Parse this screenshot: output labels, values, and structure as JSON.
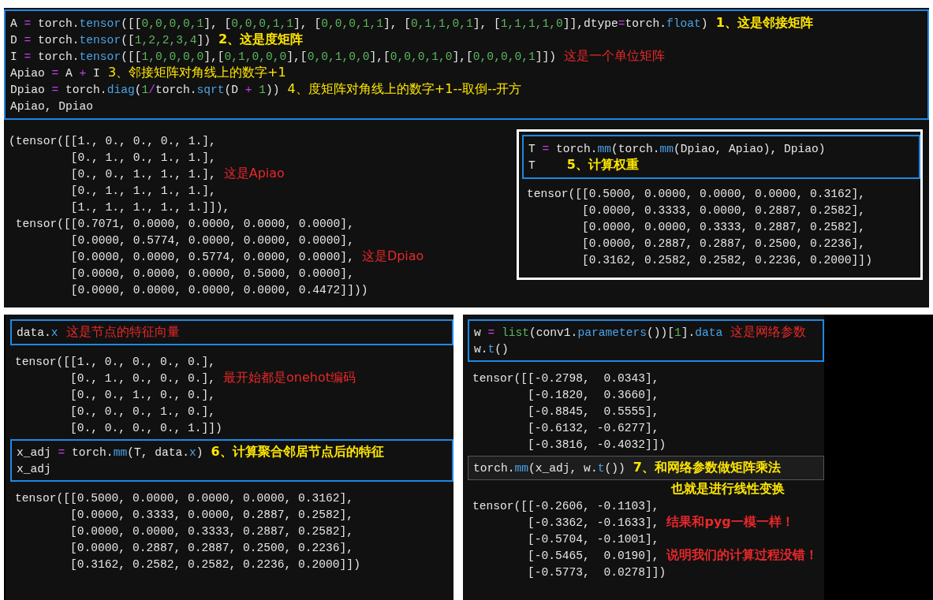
{
  "top": {
    "cell": {
      "kind": "active",
      "lines": [
        {
          "tokens": [
            {
              "text": "A ",
              "kind": "plain"
            },
            {
              "text": "=",
              "kind": "op"
            },
            {
              "text": " torch.",
              "kind": "plain"
            },
            {
              "text": "tensor",
              "kind": "attr"
            },
            {
              "text": "([[",
              "kind": "plain"
            },
            {
              "text": "0,0,0,0,1",
              "kind": "num"
            },
            {
              "text": "], [",
              "kind": "plain"
            },
            {
              "text": "0,0,0,1,1",
              "kind": "num"
            },
            {
              "text": "], [",
              "kind": "plain"
            },
            {
              "text": "0,0,0,1,1",
              "kind": "num"
            },
            {
              "text": "], [",
              "kind": "plain"
            },
            {
              "text": "0,1,1,0,1",
              "kind": "num"
            },
            {
              "text": "], [",
              "kind": "plain"
            },
            {
              "text": "1,1,1,1,0",
              "kind": "num"
            },
            {
              "text": "]],dtype",
              "kind": "plain"
            },
            {
              "text": "=",
              "kind": "op"
            },
            {
              "text": "torch.",
              "kind": "plain"
            },
            {
              "text": "float",
              "kind": "attr"
            },
            {
              "text": ")",
              "kind": "plain"
            }
          ],
          "note": {
            "text": "1、这是邻接矩阵",
            "kind": "step"
          }
        },
        {
          "tokens": [
            {
              "text": "D ",
              "kind": "plain"
            },
            {
              "text": "=",
              "kind": "op"
            },
            {
              "text": " torch.",
              "kind": "plain"
            },
            {
              "text": "tensor",
              "kind": "attr"
            },
            {
              "text": "([",
              "kind": "plain"
            },
            {
              "text": "1,2,2,3,4",
              "kind": "num"
            },
            {
              "text": "])",
              "kind": "plain"
            }
          ],
          "note": {
            "text": "2、这是度矩阵",
            "kind": "step"
          }
        },
        {
          "tokens": [
            {
              "text": "I ",
              "kind": "plain"
            },
            {
              "text": "=",
              "kind": "op"
            },
            {
              "text": " torch.",
              "kind": "plain"
            },
            {
              "text": "tensor",
              "kind": "attr"
            },
            {
              "text": "([[",
              "kind": "plain"
            },
            {
              "text": "1,0,0,0,0",
              "kind": "num"
            },
            {
              "text": "],[",
              "kind": "plain"
            },
            {
              "text": "0,1,0,0,0",
              "kind": "num"
            },
            {
              "text": "],[",
              "kind": "plain"
            },
            {
              "text": "0,0,1,0,0",
              "kind": "num"
            },
            {
              "text": "],[",
              "kind": "plain"
            },
            {
              "text": "0,0,0,1,0",
              "kind": "num"
            },
            {
              "text": "],[",
              "kind": "plain"
            },
            {
              "text": "0,0,0,0,1",
              "kind": "num"
            },
            {
              "text": "]])",
              "kind": "plain"
            }
          ],
          "note": {
            "text": "这是一个单位矩阵",
            "kind": "remark"
          }
        },
        {
          "tokens": [
            {
              "text": "Apiao ",
              "kind": "plain"
            },
            {
              "text": "=",
              "kind": "op"
            },
            {
              "text": " A ",
              "kind": "plain"
            },
            {
              "text": "+",
              "kind": "op"
            },
            {
              "text": " I",
              "kind": "plain"
            }
          ],
          "note": {
            "text": "3、邻接矩阵对角线上的数字+1",
            "kind": "hint"
          }
        },
        {
          "tokens": [
            {
              "text": "Dpiao ",
              "kind": "plain"
            },
            {
              "text": "=",
              "kind": "op"
            },
            {
              "text": " torch.",
              "kind": "plain"
            },
            {
              "text": "diag",
              "kind": "attr"
            },
            {
              "text": "(",
              "kind": "plain"
            },
            {
              "text": "1",
              "kind": "num"
            },
            {
              "text": "/",
              "kind": "op"
            },
            {
              "text": "torch.",
              "kind": "plain"
            },
            {
              "text": "sqrt",
              "kind": "attr"
            },
            {
              "text": "(D ",
              "kind": "plain"
            },
            {
              "text": "+",
              "kind": "op"
            },
            {
              "text": " 1",
              "kind": "num"
            },
            {
              "text": "))",
              "kind": "plain"
            }
          ],
          "note": {
            "text": "4、度矩阵对角线上的数字+1--取倒--开方",
            "kind": "hint"
          }
        },
        {
          "tokens": [
            {
              "text": "Apiao, Dpiao",
              "kind": "plain"
            }
          ]
        }
      ]
    },
    "output": [
      {
        "text": "(tensor([[1., 0., 0., 0., 1.],"
      },
      {
        "text": "         [0., 1., 0., 1., 1.],"
      },
      {
        "text": "         [0., 0., 1., 1., 1.],",
        "note": {
          "text": "这是Apiao",
          "kind": "remark"
        }
      },
      {
        "text": "         [0., 1., 1., 1., 1.],"
      },
      {
        "text": "         [1., 1., 1., 1., 1.]]),"
      },
      {
        "text": " tensor([[0.7071, 0.0000, 0.0000, 0.0000, 0.0000],"
      },
      {
        "text": "         [0.0000, 0.5774, 0.0000, 0.0000, 0.0000],"
      },
      {
        "text": "         [0.0000, 0.0000, 0.5774, 0.0000, 0.0000],",
        "note": {
          "text": "这是Dpiao",
          "kind": "remark"
        }
      },
      {
        "text": "         [0.0000, 0.0000, 0.0000, 0.5000, 0.0000],"
      },
      {
        "text": "         [0.0000, 0.0000, 0.0000, 0.0000, 0.4472]]))"
      }
    ],
    "inset": {
      "cell": {
        "kind": "active",
        "lines": [
          {
            "tokens": [
              {
                "text": "T ",
                "kind": "plain"
              },
              {
                "text": "=",
                "kind": "op"
              },
              {
                "text": " torch.",
                "kind": "plain"
              },
              {
                "text": "mm",
                "kind": "attr"
              },
              {
                "text": "(torch.",
                "kind": "plain"
              },
              {
                "text": "mm",
                "kind": "attr"
              },
              {
                "text": "(Dpiao, Apiao), Dpiao)",
                "kind": "plain"
              }
            ]
          },
          {
            "tokens": [
              {
                "text": "T",
                "kind": "plain"
              }
            ],
            "note": {
              "text": "5、计算权重",
              "kind": "step"
            }
          }
        ]
      },
      "output": [
        {
          "text": "tensor([[0.5000, 0.0000, 0.0000, 0.0000, 0.3162],"
        },
        {
          "text": "        [0.0000, 0.3333, 0.0000, 0.2887, 0.2582],"
        },
        {
          "text": "        [0.0000, 0.0000, 0.3333, 0.2887, 0.2582],"
        },
        {
          "text": "        [0.0000, 0.2887, 0.2887, 0.2500, 0.2236],"
        },
        {
          "text": "        [0.3162, 0.2582, 0.2582, 0.2236, 0.2000]])"
        }
      ]
    }
  },
  "bottom_left": {
    "cells": [
      {
        "input": {
          "kind": "active",
          "lines": [
            {
              "tokens": [
                {
                  "text": "data.",
                  "kind": "plain"
                },
                {
                  "text": "x",
                  "kind": "attr"
                }
              ],
              "note": {
                "text": "这是节点的特征向量",
                "kind": "remark"
              }
            }
          ]
        },
        "output": [
          {
            "text": "tensor([[1., 0., 0., 0., 0.],"
          },
          {
            "text": "        [0., 1., 0., 0., 0.],",
            "note": {
              "text": "最开始都是onehot编码",
              "kind": "remark"
            }
          },
          {
            "text": "        [0., 0., 1., 0., 0.],"
          },
          {
            "text": "        [0., 0., 0., 1., 0.],"
          },
          {
            "text": "        [0., 0., 0., 0., 1.]])"
          }
        ]
      },
      {
        "input": {
          "kind": "active",
          "lines": [
            {
              "tokens": [
                {
                  "text": "x_adj ",
                  "kind": "plain"
                },
                {
                  "text": "=",
                  "kind": "op"
                },
                {
                  "text": " torch.",
                  "kind": "plain"
                },
                {
                  "text": "mm",
                  "kind": "attr"
                },
                {
                  "text": "(T, data.",
                  "kind": "plain"
                },
                {
                  "text": "x",
                  "kind": "attr"
                },
                {
                  "text": ")",
                  "kind": "plain"
                }
              ],
              "note": {
                "text": "6、计算聚合邻居节点后的特征",
                "kind": "step"
              }
            },
            {
              "tokens": [
                {
                  "text": "x_adj",
                  "kind": "plain"
                }
              ]
            }
          ]
        },
        "output": [
          {
            "text": "tensor([[0.5000, 0.0000, 0.0000, 0.0000, 0.3162],"
          },
          {
            "text": "        [0.0000, 0.3333, 0.0000, 0.2887, 0.2582],"
          },
          {
            "text": "        [0.0000, 0.0000, 0.3333, 0.2887, 0.2582],"
          },
          {
            "text": "        [0.0000, 0.2887, 0.2887, 0.2500, 0.2236],"
          },
          {
            "text": "        [0.3162, 0.2582, 0.2582, 0.2236, 0.2000]])"
          }
        ]
      }
    ]
  },
  "bottom_right": {
    "cells": [
      {
        "input": {
          "kind": "active",
          "lines": [
            {
              "tokens": [
                {
                  "text": "w ",
                  "kind": "plain"
                },
                {
                  "text": "=",
                  "kind": "op"
                },
                {
                  "text": " list",
                  "kind": "builtin"
                },
                {
                  "text": "(conv1.",
                  "kind": "plain"
                },
                {
                  "text": "parameters",
                  "kind": "attr"
                },
                {
                  "text": "())[",
                  "kind": "plain"
                },
                {
                  "text": "1",
                  "kind": "num"
                },
                {
                  "text": "].",
                  "kind": "plain"
                },
                {
                  "text": "data",
                  "kind": "attr"
                }
              ],
              "note": {
                "text": "这是网络参数",
                "kind": "remark"
              }
            },
            {
              "tokens": [
                {
                  "text": "w.",
                  "kind": "plain"
                },
                {
                  "text": "t",
                  "kind": "attr"
                },
                {
                  "text": "()",
                  "kind": "plain"
                }
              ]
            }
          ]
        },
        "output": [
          {
            "text": "tensor([[-0.2798,  0.0343],"
          },
          {
            "text": "        [-0.1820,  0.3660],"
          },
          {
            "text": "        [-0.8845,  0.5555],"
          },
          {
            "text": "        [-0.6132, -0.6277],"
          },
          {
            "text": "        [-0.3816, -0.4032]])"
          }
        ]
      },
      {
        "input": {
          "kind": "idle",
          "lines": [
            {
              "tokens": [
                {
                  "text": "torch.",
                  "kind": "plain"
                },
                {
                  "text": "mm",
                  "kind": "attr"
                },
                {
                  "text": "(x_adj, w.",
                  "kind": "plain"
                },
                {
                  "text": "t",
                  "kind": "attr"
                },
                {
                  "text": "())",
                  "kind": "plain"
                }
              ],
              "note": {
                "text": "7、和网络参数做矩阵乘法",
                "kind": "step"
              }
            }
          ]
        },
        "caption": {
          "text": "也就是进行线性变换",
          "kind": "step"
        },
        "output": [
          {
            "text": "tensor([[-0.2606, -0.1103],"
          },
          {
            "text": "        [-0.3362, -0.1633],",
            "note": {
              "text": "结果和pyg一模一样！",
              "kind": "verdict"
            }
          },
          {
            "text": "        [-0.5704, -0.1001],"
          },
          {
            "text": "        [-0.5465,  0.0190],",
            "note": {
              "text": "说明我们的计算过程没错！",
              "kind": "verdict"
            }
          },
          {
            "text": "        [-0.5773,  0.0278]])"
          }
        ]
      }
    ]
  }
}
